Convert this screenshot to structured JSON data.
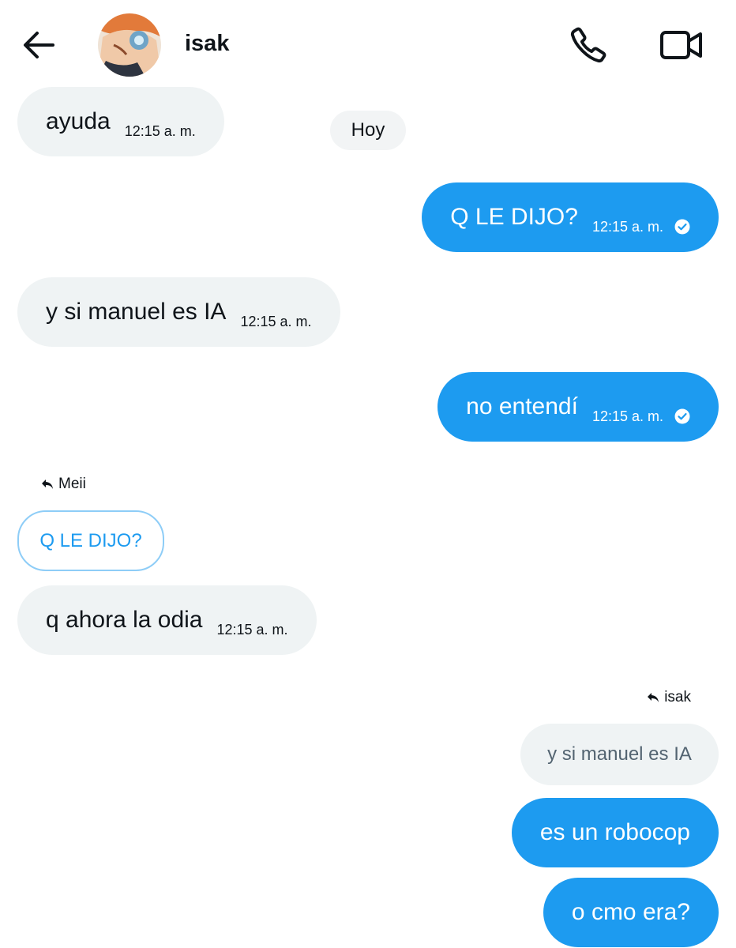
{
  "header": {
    "contact_name": "isak",
    "icons": [
      "back-arrow-icon",
      "phone-icon",
      "video-camera-icon"
    ]
  },
  "date_divider": "Hoy",
  "messages": [
    {
      "direction": "incoming",
      "text": "ayuda",
      "time": "12:15 a. m."
    },
    {
      "direction": "outgoing",
      "text": "Q LE DIJO?",
      "time": "12:15 a. m.",
      "read": true
    },
    {
      "direction": "incoming",
      "text": "y si manuel es IA",
      "time": "12:15 a. m."
    },
    {
      "direction": "outgoing",
      "text": "no entendí",
      "time": "12:15 a. m.",
      "read": true
    },
    {
      "direction": "incoming",
      "reply_to": {
        "author": "Meii",
        "text": "Q LE DIJO?"
      },
      "text": "q ahora la odia",
      "time": "12:15 a. m."
    },
    {
      "direction": "outgoing",
      "reply_to": {
        "author": "isak",
        "text": "y si manuel es IA"
      },
      "text": "es un robocop"
    },
    {
      "direction": "outgoing",
      "text": "o cmo era?"
    }
  ],
  "colors": {
    "accent": "#1d9bf0",
    "incoming_bubble": "#eff3f4",
    "text": "#0f1419",
    "muted": "#536471"
  }
}
